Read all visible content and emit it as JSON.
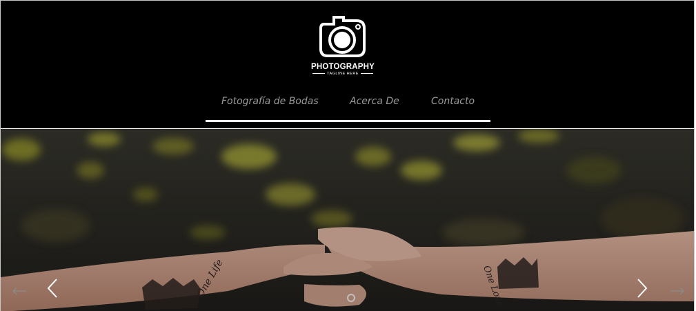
{
  "logo": {
    "title": "PHOTOGRAPHY",
    "tagline": "TAGLINE HERE",
    "icon": "camera-icon"
  },
  "nav": {
    "items": [
      {
        "label": "Fotografía de Bodas"
      },
      {
        "label": "Acerca De"
      },
      {
        "label": "Contacto"
      }
    ]
  },
  "slider": {
    "prev_icon": "chevron-left-icon",
    "next_icon": "chevron-right-icon",
    "prev_arrow_icon": "arrow-left-icon",
    "next_arrow_icon": "arrow-right-icon"
  },
  "colors": {
    "header_bg": "#000000",
    "nav_text": "#9a9a9a",
    "nav_underline": "#ffffff"
  }
}
